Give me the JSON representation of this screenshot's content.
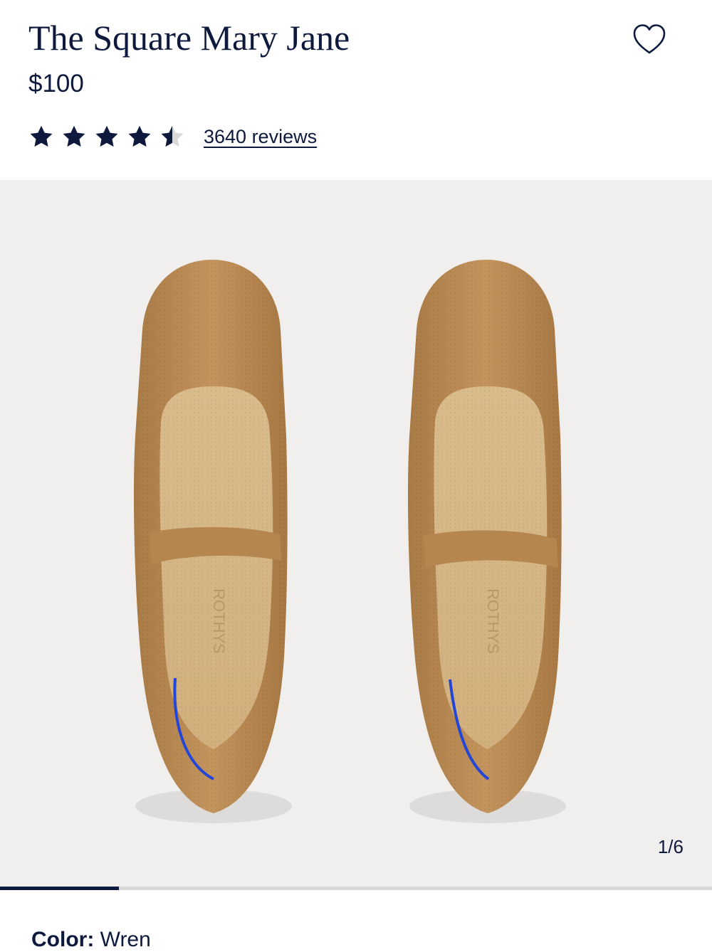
{
  "product": {
    "title": "The Square Mary Jane",
    "price": "$100",
    "rating": 4.5,
    "rating_max": 5,
    "reviews_text": "3640 reviews"
  },
  "gallery": {
    "counter": "1/6",
    "progress": 0.1667,
    "insole_brand": "ROTHYS"
  },
  "color": {
    "label": "Color:",
    "value": "Wren"
  },
  "icons": {
    "wishlist": "heart-outline-icon",
    "star": "star-icon"
  },
  "colors": {
    "text_navy": "#0e1a3d",
    "gallery_bg": "#f0efed",
    "shoe_tan": "#b98a55",
    "insole": "#d6b483",
    "stitch_blue": "#2346d6"
  }
}
